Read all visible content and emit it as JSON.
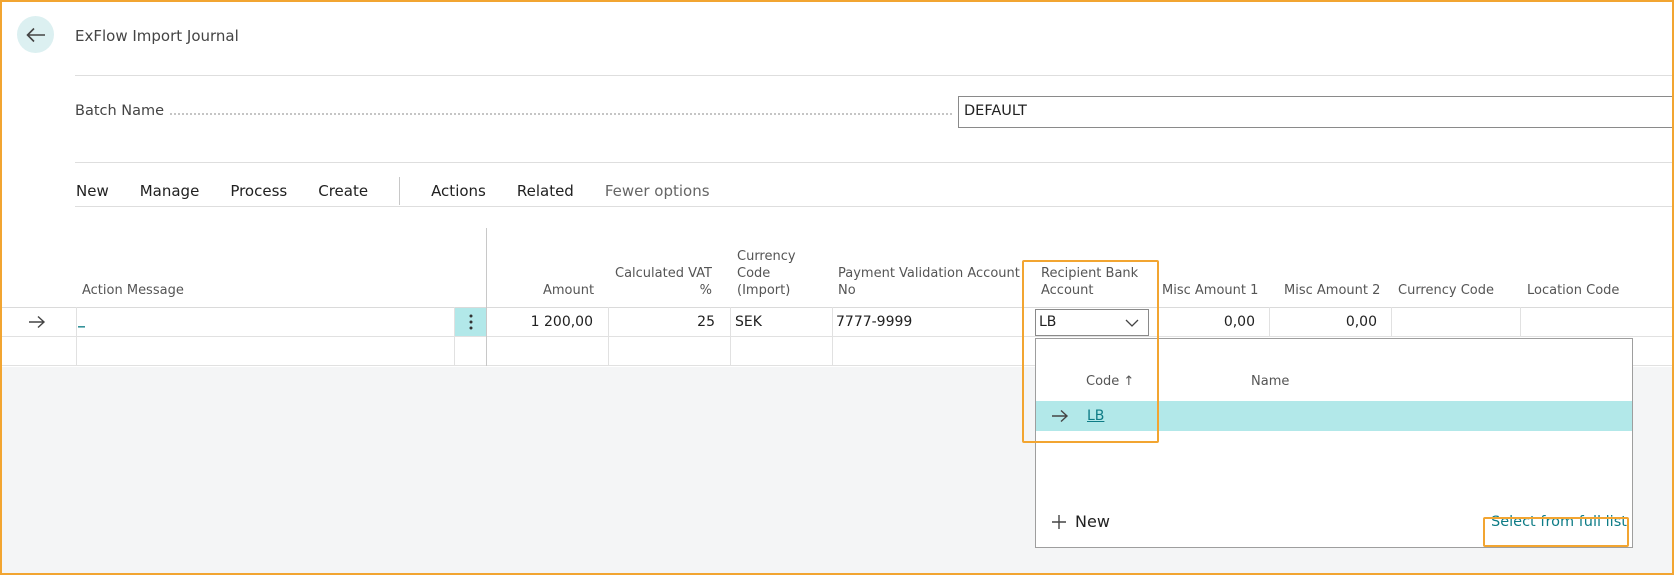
{
  "page": {
    "title": "ExFlow Import Journal"
  },
  "batch": {
    "label": "Batch Name",
    "value": "DEFAULT"
  },
  "actions": {
    "new": "New",
    "manage": "Manage",
    "process": "Process",
    "create": "Create",
    "actions": "Actions",
    "related": "Related",
    "fewer_options": "Fewer options"
  },
  "columns": {
    "action_message": "Action Message",
    "amount": "Amount",
    "calculated_vat": [
      "Calculated VAT",
      "%"
    ],
    "currency_code_import": [
      "Currency",
      "Code",
      "(Import)"
    ],
    "payment_validation": [
      "Payment Validation Account",
      "No"
    ],
    "recipient_bank": [
      "Recipient Bank",
      "Account"
    ],
    "misc_amount_1": "Misc Amount 1",
    "misc_amount_2": "Misc Amount 2",
    "currency_code": "Currency Code",
    "location_code": "Location Code"
  },
  "row1": {
    "action_message": "_",
    "amount": "1 200,00",
    "calculated_vat": "25",
    "currency_code_import": "SEK",
    "payment_validation": "7777-9999",
    "recipient_bank": "LB",
    "misc_amount_1": "0,00",
    "misc_amount_2": "0,00",
    "currency_code": "",
    "location_code": ""
  },
  "lookup": {
    "code_header": "Code",
    "name_header": "Name",
    "rows": [
      {
        "code": "LB",
        "name": ""
      }
    ],
    "new_label": "New",
    "select_full_list": "Select from full list"
  },
  "colors": {
    "accent": "#0e7c86",
    "highlight": "#b2e8e9",
    "outline": "#f2a531"
  }
}
